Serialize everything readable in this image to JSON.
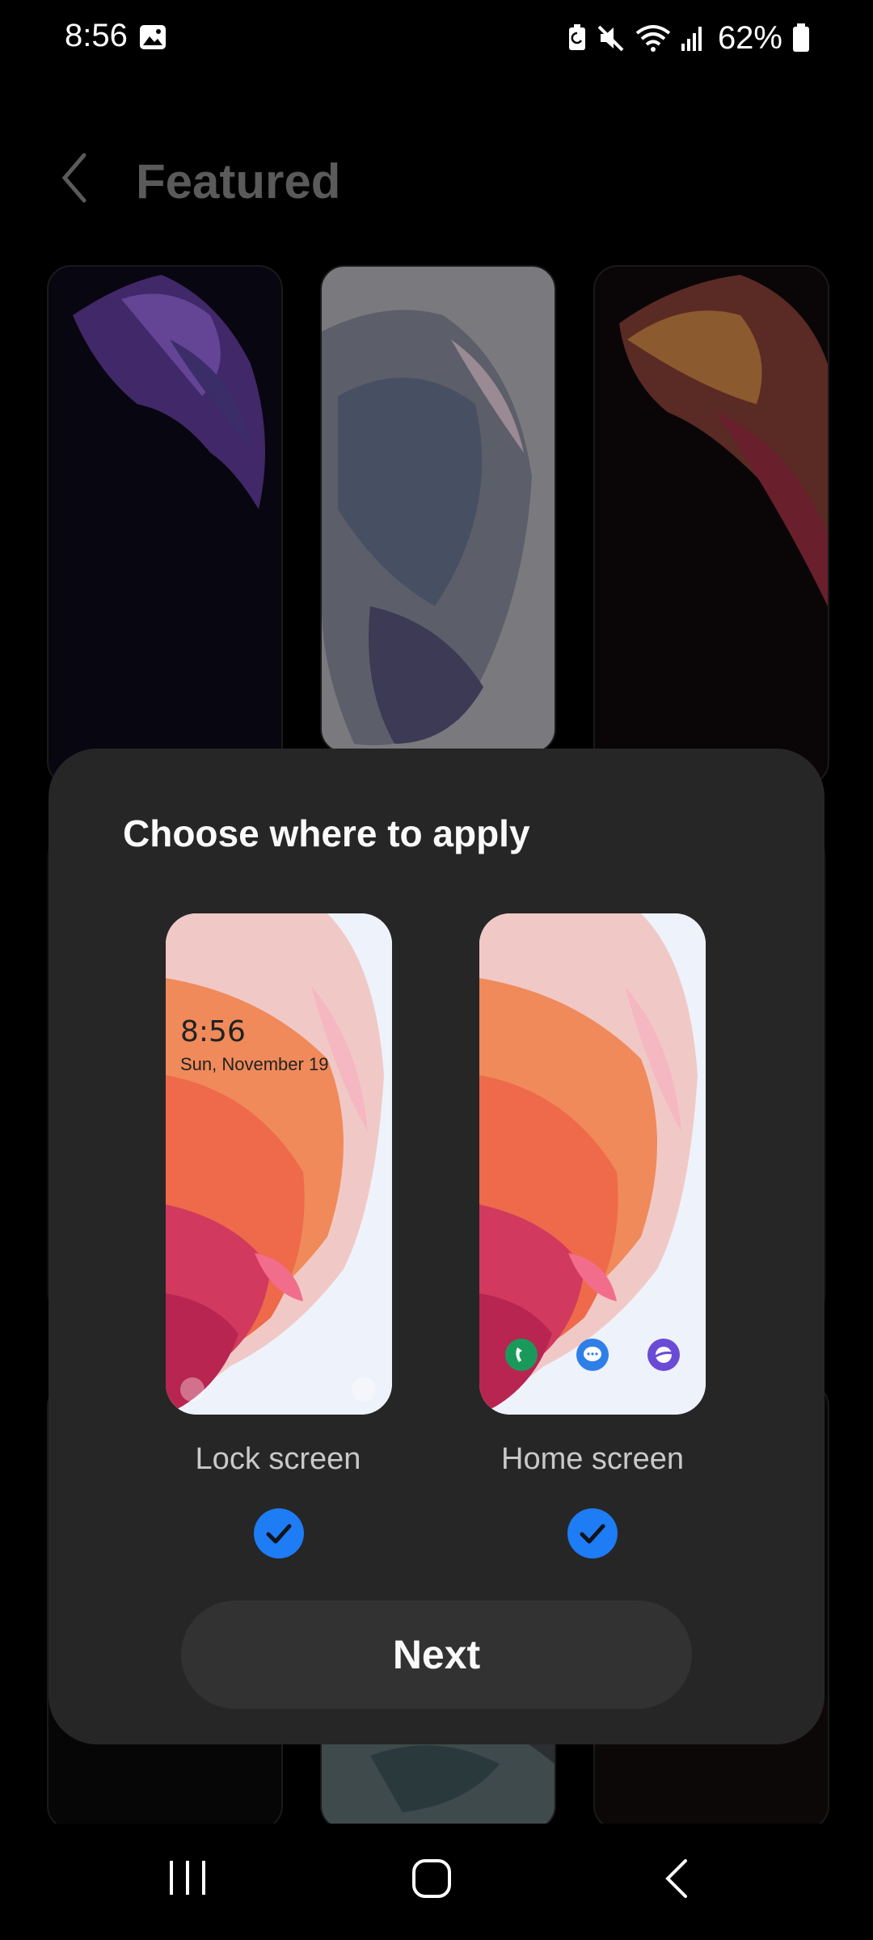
{
  "status_bar": {
    "time": "8:56",
    "battery": "62%",
    "icons": [
      "gallery-icon",
      "battery-saver-icon",
      "mute-icon",
      "wifi-icon",
      "signal-icon",
      "battery-icon"
    ]
  },
  "header": {
    "title": "Featured",
    "back_icon": "back-icon"
  },
  "dialog": {
    "title": "Choose where to apply",
    "lock_screen": {
      "label": "Lock screen",
      "preview_time": "8:56",
      "preview_date": "Sun, November 19",
      "checked": true
    },
    "home_screen": {
      "label": "Home screen",
      "apps": [
        "phone-app-icon",
        "messages-app-icon",
        "internet-app-icon"
      ],
      "checked": true
    },
    "next_label": "Next"
  },
  "nav_bar": {
    "icons": [
      "recent-apps-icon",
      "home-icon",
      "back-nav-icon"
    ]
  },
  "colors": {
    "accent": "#1e7cf4",
    "dialog_bg": "#262626",
    "button_bg": "#323232"
  }
}
